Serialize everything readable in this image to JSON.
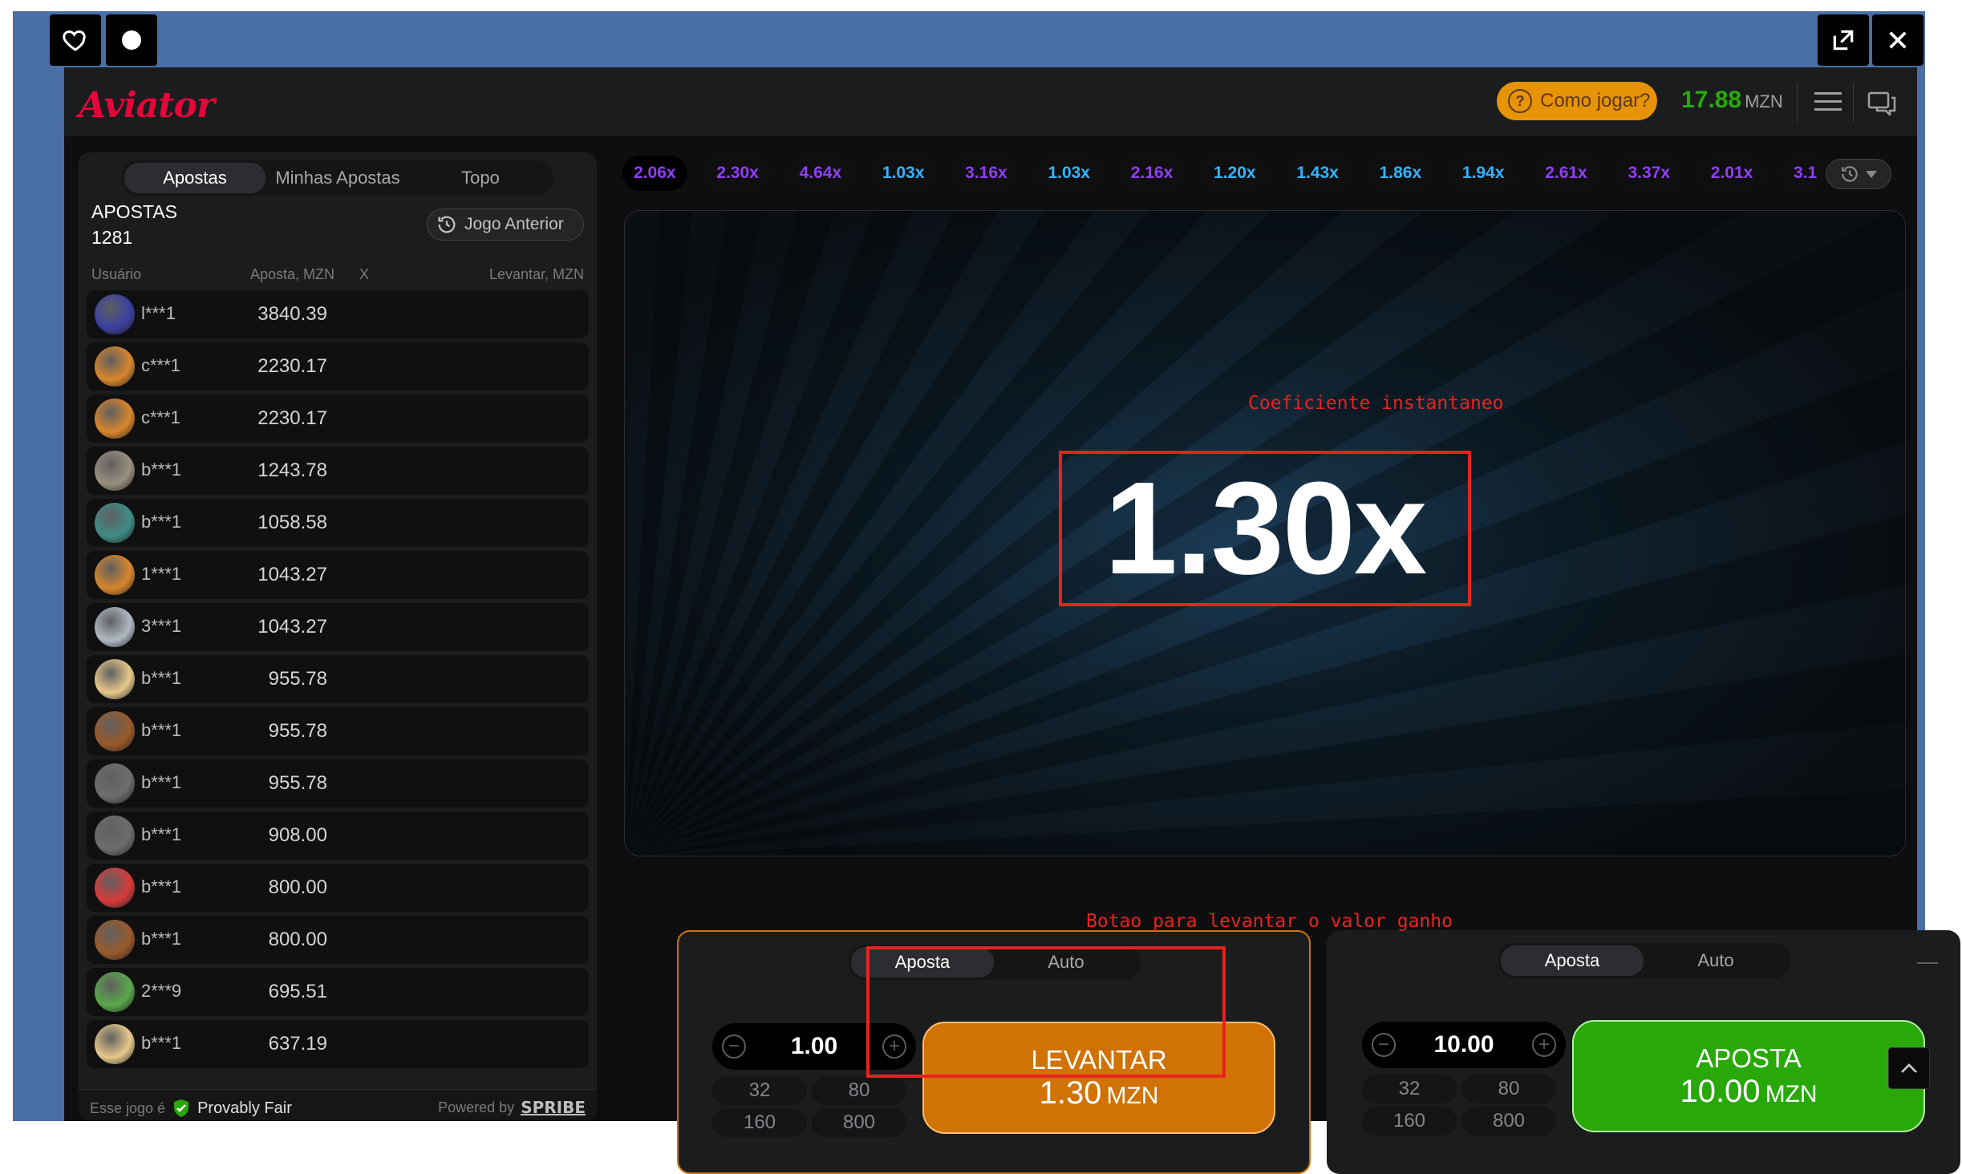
{
  "window": {
    "favorite_icon": "heart-icon",
    "theme_icon": "circle-icon",
    "expand_icon": "expand-icon",
    "close_icon": "close-icon"
  },
  "header": {
    "logo": "Aviator",
    "how_to_play": "Como jogar?",
    "balance": "17.88",
    "currency": "MZN"
  },
  "left_panel": {
    "tabs": [
      "Apostas",
      "Minhas Apostas",
      "Topo"
    ],
    "active_tab": "Apostas",
    "bets_label": "APOSTAS",
    "bets_count": "1281",
    "previous_game": "Jogo Anterior",
    "columns": {
      "user": "Usuário",
      "bet": "Aposta, MZN",
      "x": "X",
      "cashout": "Levantar, MZN"
    },
    "rows": [
      {
        "user": "l***1",
        "amount": "3840.39",
        "avatar": "#3a3fa0"
      },
      {
        "user": "c***1",
        "amount": "2230.17",
        "avatar": "#d8852c"
      },
      {
        "user": "c***1",
        "amount": "2230.17",
        "avatar": "#d8852c"
      },
      {
        "user": "b***1",
        "amount": "1243.78",
        "avatar": "#9a8f7e"
      },
      {
        "user": "b***1",
        "amount": "1058.58",
        "avatar": "#3f8c86"
      },
      {
        "user": "1***1",
        "amount": "1043.27",
        "avatar": "#d8852c"
      },
      {
        "user": "3***1",
        "amount": "1043.27",
        "avatar": "#b0b8c4"
      },
      {
        "user": "b***1",
        "amount": "955.78",
        "avatar": "#e6c88a"
      },
      {
        "user": "b***1",
        "amount": "955.78",
        "avatar": "#9a5a2a"
      },
      {
        "user": "b***1",
        "amount": "955.78",
        "avatar": "#6d6d70"
      },
      {
        "user": "b***1",
        "amount": "908.00",
        "avatar": "#6d6d70"
      },
      {
        "user": "b***1",
        "amount": "800.00",
        "avatar": "#d83a3a"
      },
      {
        "user": "b***1",
        "amount": "800.00",
        "avatar": "#9a5a2a"
      },
      {
        "user": "2***9",
        "amount": "695.51",
        "avatar": "#5aa84a"
      },
      {
        "user": "b***1",
        "amount": "637.19",
        "avatar": "#e6c88a"
      }
    ],
    "footer": {
      "prefix": "Esse jogo é",
      "provably_fair": "Provably Fair",
      "powered_by": "Powered by",
      "brand": "SPRIBE"
    }
  },
  "history": [
    {
      "value": "2.06x",
      "color": "#913ef8"
    },
    {
      "value": "2.30x",
      "color": "#913ef8"
    },
    {
      "value": "4.64x",
      "color": "#913ef8"
    },
    {
      "value": "1.03x",
      "color": "#34b4ff"
    },
    {
      "value": "3.16x",
      "color": "#913ef8"
    },
    {
      "value": "1.03x",
      "color": "#34b4ff"
    },
    {
      "value": "2.16x",
      "color": "#913ef8"
    },
    {
      "value": "1.20x",
      "color": "#34b4ff"
    },
    {
      "value": "1.43x",
      "color": "#34b4ff"
    },
    {
      "value": "1.86x",
      "color": "#34b4ff"
    },
    {
      "value": "1.94x",
      "color": "#34b4ff"
    },
    {
      "value": "2.61x",
      "color": "#913ef8"
    },
    {
      "value": "3.37x",
      "color": "#913ef8"
    },
    {
      "value": "2.01x",
      "color": "#913ef8"
    },
    {
      "value": "3.1",
      "color": "#913ef8"
    }
  ],
  "game": {
    "annotation_coef": "Coeficiente instantaneo",
    "multiplier": "1.30x",
    "annotation_button": "Botao para levantar o valor ganho"
  },
  "bet_panel_1": {
    "tabs": [
      "Aposta",
      "Auto"
    ],
    "amount": "1.00",
    "quick": [
      "32",
      "80",
      "160",
      "800"
    ],
    "button_label": "LEVANTAR",
    "button_amount": "1.30",
    "button_currency": "MZN"
  },
  "bet_panel_2": {
    "tabs": [
      "Aposta",
      "Auto"
    ],
    "amount": "10.00",
    "quick": [
      "32",
      "80",
      "160",
      "800"
    ],
    "button_label": "APOSTA",
    "button_amount": "10.00",
    "button_currency": "MZN"
  }
}
